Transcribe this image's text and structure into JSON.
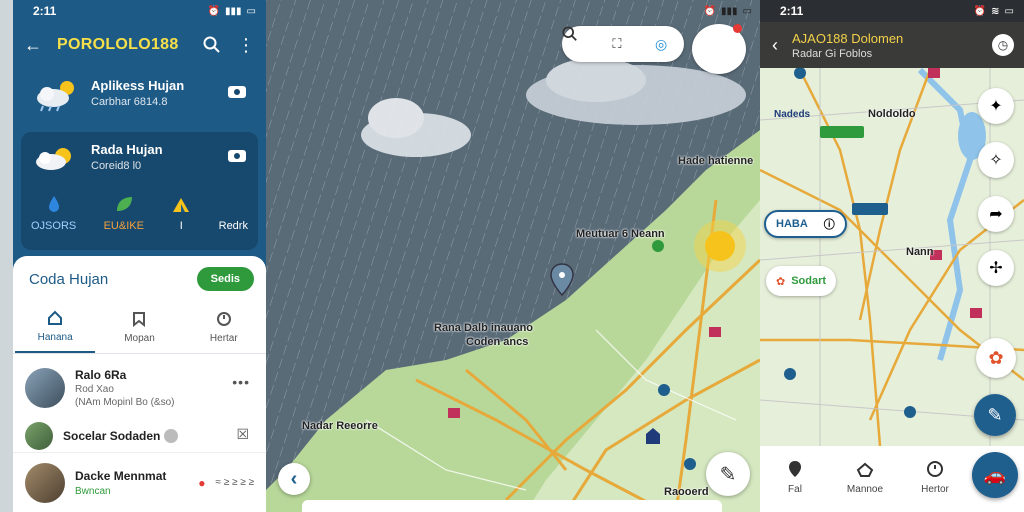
{
  "left": {
    "status_time": "2:11",
    "app_title": "POROLOLO188",
    "card1": {
      "title": "Aplikess Hujan",
      "subtitle": "Carbhar 6814.8"
    },
    "card2": {
      "title": "Rada Hujan",
      "subtitle": "Coreid8 l0"
    },
    "actions": [
      {
        "label": "OJSORS",
        "icon": "drop-icon"
      },
      {
        "label": "EU&IKE",
        "icon": "leaf-icon"
      },
      {
        "label": "I",
        "icon": "tent-icon"
      },
      {
        "label": "Redrk",
        "icon": "radar-icon"
      }
    ],
    "sheet": {
      "title": "Coda Hujan",
      "button": "Sedis",
      "tabs": [
        {
          "label": "Hanana",
          "icon": "home-icon"
        },
        {
          "label": "Mopan",
          "icon": "bookmark-icon"
        },
        {
          "label": "Hertar",
          "icon": "clock-icon"
        }
      ],
      "items": [
        {
          "title": "Ralo 6Ra",
          "line1": "Rod Xao",
          "line2": "(NAm Mopinl Bo (&so)"
        },
        {
          "title": "Socelar Sodaden",
          "line1": "",
          "line2": ""
        },
        {
          "title": "Dacke Mennmat",
          "line1": "Bwncan",
          "line2": ""
        }
      ],
      "item3_count": "≈ ≥ ≥ ≥ ≥"
    }
  },
  "middle": {
    "labels": [
      "Hade hatienne",
      "Meutuar 6 Neann",
      "Rana Dalb inauano",
      "Coden ancs",
      "Nadar Reeorre"
    ],
    "bottom_label": "Raooerd"
  },
  "right": {
    "status_time": "2:11",
    "title": "AJAO188 Dolomen",
    "subtitle": "Radar Gi Foblos",
    "map_labels": [
      "Nadeds",
      "Noldoldo",
      "Nann",
      "Sociart"
    ],
    "pill1": "HABA",
    "pill2": "Sodart",
    "nav": [
      {
        "label": "Fal",
        "icon": "pin-icon"
      },
      {
        "label": "Mannoe",
        "icon": "hat-icon"
      },
      {
        "label": "Hertor",
        "icon": "clock-icon"
      }
    ]
  }
}
